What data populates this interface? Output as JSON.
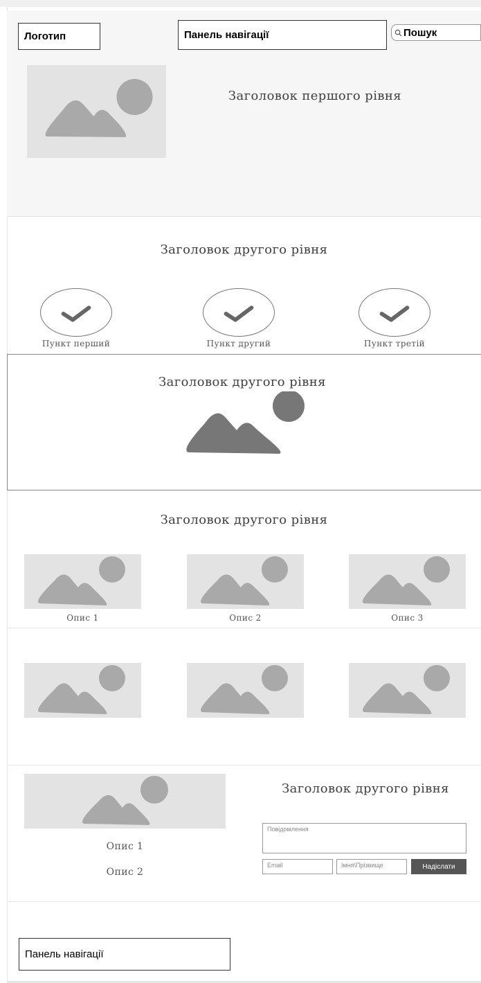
{
  "header": {
    "logo_label": "Логотип",
    "nav_label": "Панель навігації",
    "search_placeholder": "Пошук"
  },
  "hero": {
    "title": "Заголовок першого рівня"
  },
  "features": {
    "title": "Заголовок другого рівня",
    "items": [
      {
        "label": "Пункт перший"
      },
      {
        "label": "Пункт другий"
      },
      {
        "label": "Пункт третій"
      }
    ]
  },
  "banner": {
    "title": "Заголовок другого рівня"
  },
  "gallery": {
    "title": "Заголовок другого рівня",
    "captions": [
      "Опис 1",
      "Опис 2",
      "Опис 3"
    ]
  },
  "contact": {
    "title": "Заголовок другого рівня",
    "descriptions": [
      "Опис 1",
      "Опис 2"
    ],
    "message_placeholder": "Повідомлення",
    "email_placeholder": "Email",
    "name_placeholder": "Імня\\Прізвище",
    "submit_label": "Надіслати"
  },
  "footer": {
    "nav_label": "Панель навігації"
  },
  "colors": {
    "placeholder_bg": "#e3e3e3",
    "placeholder_shape": "#a9a9a9",
    "banner_shape": "#777777",
    "button_bg": "#555555"
  }
}
